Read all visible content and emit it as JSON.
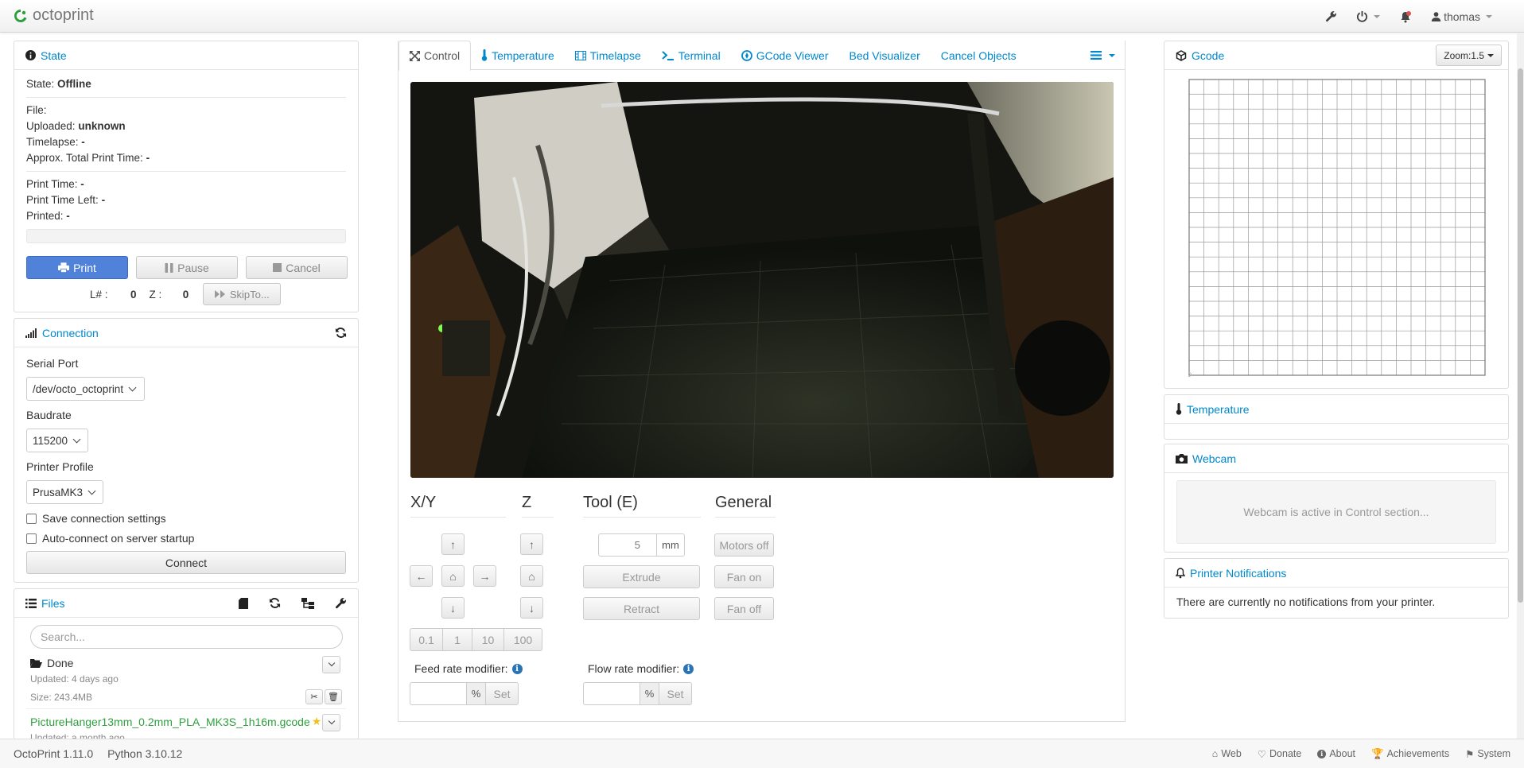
{
  "navbar": {
    "brand": "octoprint",
    "user": "thomas"
  },
  "state": {
    "title": "State",
    "state_label": "State:",
    "state_value": "Offline",
    "file_label": "File:",
    "uploaded_label": "Uploaded:",
    "uploaded_value": "unknown",
    "timelapse_label": "Timelapse:",
    "timelapse_value": "-",
    "approx_label": "Approx. Total Print Time:",
    "approx_value": "-",
    "print_time_label": "Print Time:",
    "print_time_value": "-",
    "time_left_label": "Print Time Left:",
    "time_left_value": "-",
    "printed_label": "Printed:",
    "printed_value": "-",
    "print_btn": "Print",
    "pause_btn": "Pause",
    "cancel_btn": "Cancel",
    "line_label": "L# :",
    "line_value": "0",
    "z_label": "Z :",
    "z_value": "0",
    "skip_btn": "SkipTo..."
  },
  "connection": {
    "title": "Connection",
    "serial_label": "Serial Port",
    "serial_value": "/dev/octo_octoprint",
    "baud_label": "Baudrate",
    "baud_value": "115200",
    "profile_label": "Printer Profile",
    "profile_value": "PrusaMK3",
    "save_label": "Save connection settings",
    "auto_label": "Auto-connect on server startup",
    "connect_btn": "Connect"
  },
  "files": {
    "title": "Files",
    "search_placeholder": "Search...",
    "folder_name": "Done",
    "folder_updated": "Updated: 4 days ago",
    "folder_size": "Size: 243.4MB",
    "file_name": "PictureHanger13mm_0.2mm_PLA_MK3S_1h16m.gcode",
    "file_updated": "Updated: a month ago"
  },
  "tabs": [
    {
      "label": "Control",
      "icon": "arrows-icon"
    },
    {
      "label": "Temperature",
      "icon": "thermometer-icon"
    },
    {
      "label": "Timelapse",
      "icon": "film-icon"
    },
    {
      "label": "Terminal",
      "icon": "terminal-icon"
    },
    {
      "label": "GCode Viewer",
      "icon": "compass-icon"
    },
    {
      "label": "Bed Visualizer",
      "icon": ""
    },
    {
      "label": "Cancel Objects",
      "icon": ""
    }
  ],
  "control": {
    "xy_heading": "X/Y",
    "z_heading": "Z",
    "tool_heading": "Tool (E)",
    "general_heading": "General",
    "step_sizes": [
      "0.1",
      "1",
      "10",
      "100"
    ],
    "extrude_amount": "5",
    "unit_mm": "mm",
    "extrude_btn": "Extrude",
    "retract_btn": "Retract",
    "motors_off_btn": "Motors off",
    "fan_on_btn": "Fan on",
    "fan_off_btn": "Fan off",
    "feed_label": "Feed rate modifier:",
    "flow_label": "Flow rate modifier:",
    "percent": "%",
    "set_btn": "Set"
  },
  "gcode_panel": {
    "title": "Gcode",
    "zoom": "Zoom:1.5"
  },
  "temperature_panel": {
    "title": "Temperature"
  },
  "webcam_panel": {
    "title": "Webcam",
    "message": "Webcam is active in Control section..."
  },
  "notifications_panel": {
    "title": "Printer Notifications",
    "message": "There are currently no notifications from your printer."
  },
  "footer": {
    "version": "OctoPrint 1.11.0",
    "python": "Python 3.10.12",
    "links": [
      "Web",
      "Donate",
      "About",
      "Achievements",
      "System"
    ]
  },
  "colors": {
    "accent": "#0088cc",
    "primary_button": "#4f82d8",
    "brand_logo": "#2e9f3e"
  }
}
